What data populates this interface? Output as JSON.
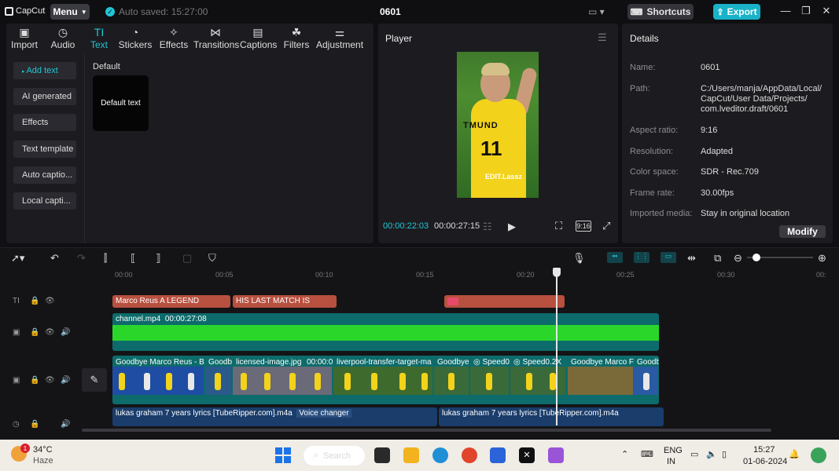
{
  "titlebar": {
    "logo": "CapCut",
    "menu_label": "Menu",
    "autosave": "Auto saved: 15:27:00",
    "project_title": "0601",
    "shortcuts_label": "Shortcuts",
    "export_label": "Export"
  },
  "toolbar_tabs": [
    {
      "label": "Import",
      "icon": "import-icon",
      "glyph": "▣"
    },
    {
      "label": "Audio",
      "icon": "audio-icon",
      "glyph": "◷"
    },
    {
      "label": "Text",
      "icon": "text-icon",
      "glyph": "TI",
      "active": true
    },
    {
      "label": "Stickers",
      "icon": "stickers-icon",
      "glyph": "◔"
    },
    {
      "label": "Effects",
      "icon": "effects-icon",
      "glyph": "✧"
    },
    {
      "label": "Transitions",
      "icon": "transitions-icon",
      "glyph": "⋈"
    },
    {
      "label": "Captions",
      "icon": "captions-icon",
      "glyph": "▤"
    },
    {
      "label": "Filters",
      "icon": "filters-icon",
      "glyph": "☘"
    },
    {
      "label": "Adjustment",
      "icon": "adjustment-icon",
      "glyph": "⚌"
    }
  ],
  "side_menu": [
    "Add text",
    "AI generated",
    "Effects",
    "Text template",
    "Auto captio...",
    "Local capti..."
  ],
  "text_panel": {
    "section_label": "Default",
    "card_label": "Default text"
  },
  "player": {
    "title": "Player",
    "current_time": "00:00:22:03",
    "total_time": "00:00:27:15",
    "ratio_label": "9:16",
    "frame": {
      "jersey_name": "TMUND",
      "jersey_number": "11",
      "watermark": "EDIT.Lassz"
    }
  },
  "details": {
    "title": "Details",
    "rows": [
      {
        "label": "Name:",
        "value": "0601"
      },
      {
        "label": "Path:",
        "value": "C:/Users/manja/AppData/Local/ CapCut/User Data/Projects/ com.lveditor.draft/0601"
      },
      {
        "label": "Aspect ratio:",
        "value": "9:16"
      },
      {
        "label": "Resolution:",
        "value": "Adapted"
      },
      {
        "label": "Color space:",
        "value": "SDR - Rec.709"
      },
      {
        "label": "Frame rate:",
        "value": "30.00fps"
      },
      {
        "label": "Imported media:",
        "value": "Stay in original location"
      }
    ],
    "modify_label": "Modify"
  },
  "timeline": {
    "ruler": [
      "00:00",
      "00:05",
      "00:10",
      "00:15",
      "00:20",
      "00:25",
      "00:30",
      "00:"
    ],
    "text_clips": [
      "Marco Reus A LEGEND",
      "HIS LAST MATCH IS",
      ""
    ],
    "main_clip": {
      "name": "channel.mp4",
      "duration": "00:00:27:08"
    },
    "video_clips": [
      "Goodbye Marco Reus - B",
      "Goodb",
      "licensed-image.jpg",
      "00:00:0",
      "liverpool-transfer-target-ma",
      "Goodbye",
      "Speed0",
      "Speed0.2X",
      "Goodbye Marco F",
      "Goodb"
    ],
    "audio_clips": [
      "lukas graham 7 years lyrics [TubeRipper.com].m4a",
      "Voice changer",
      "lukas graham 7 years lyrics [TubeRipper.com].m4a"
    ]
  },
  "taskbar": {
    "temperature": "34°C",
    "weather": "Haze",
    "weather_badge": "1",
    "search_label": "Search",
    "lang_line1": "ENG",
    "lang_line2": "IN",
    "clock_time": "15:27",
    "clock_date": "01-06-2024"
  },
  "colors": {
    "accent": "#21c6d6",
    "text_clip": "#b8503f",
    "main_track": "#2bd62b",
    "video_track": "#0d6b6b",
    "audio_track": "#1b3d6b"
  }
}
